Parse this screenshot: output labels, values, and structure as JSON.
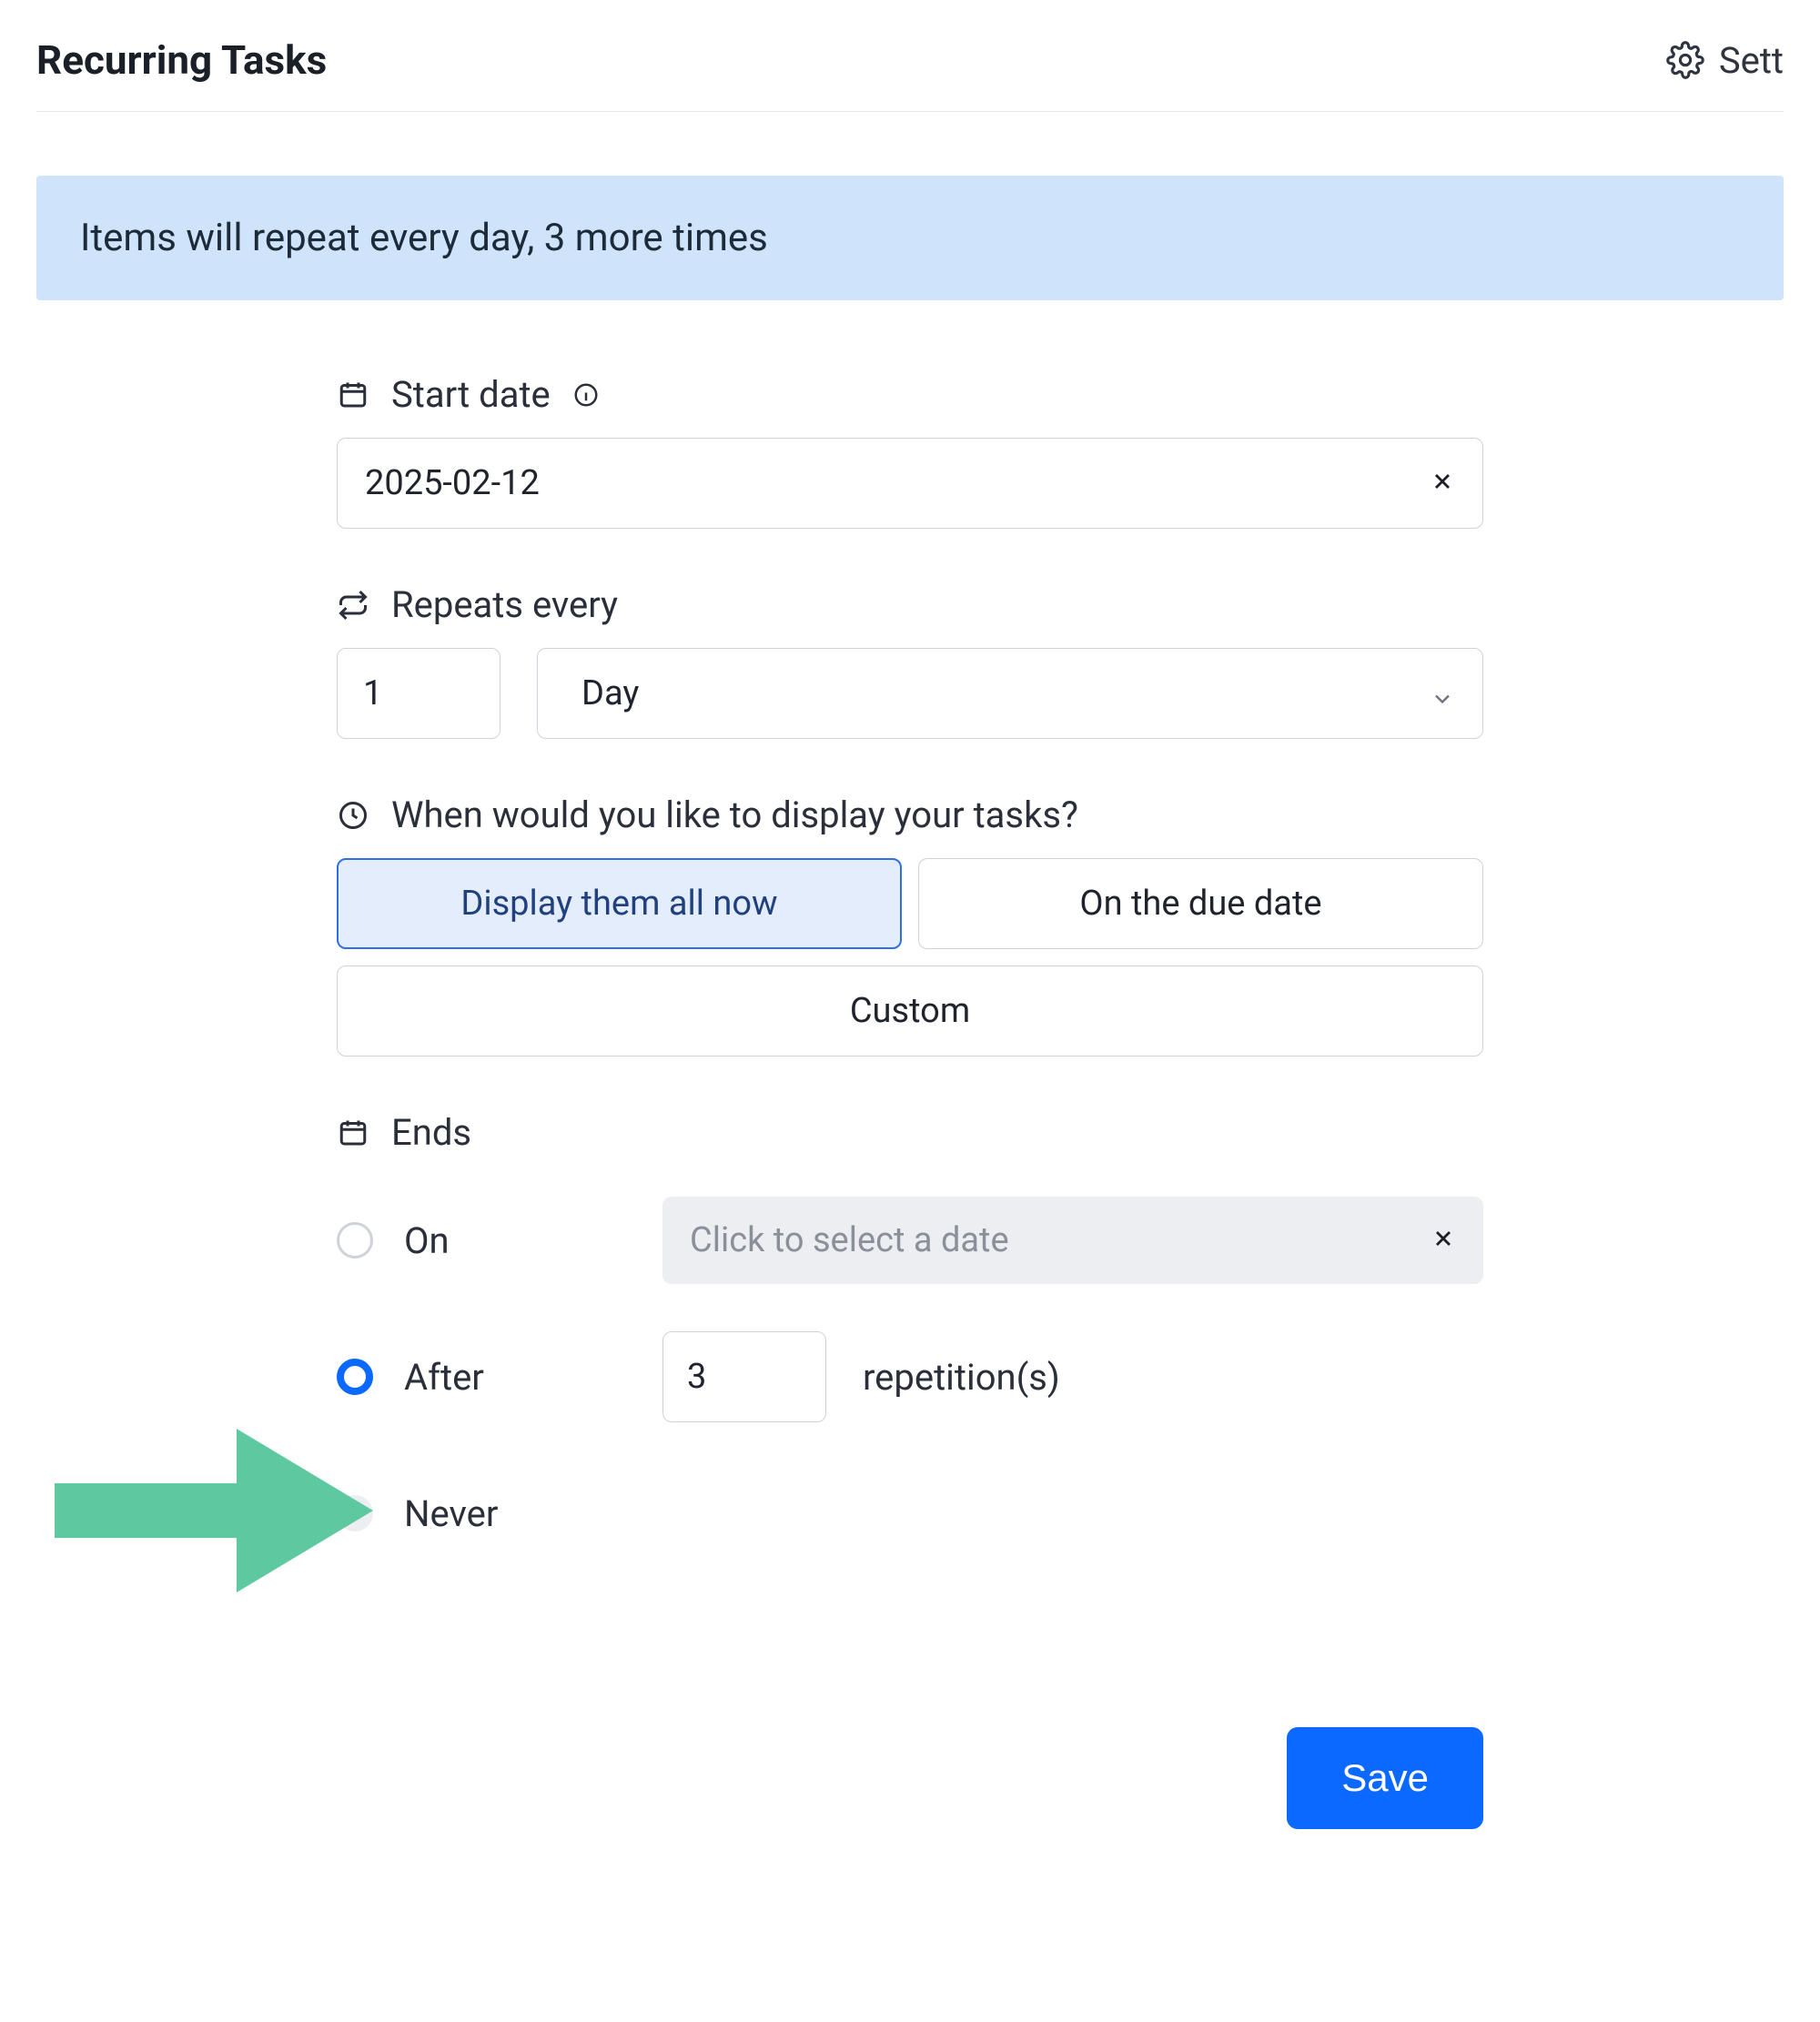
{
  "header": {
    "title": "Recurring Tasks",
    "settings_label": "Sett"
  },
  "banner": {
    "text": "Items will repeat every day, 3 more times"
  },
  "start_date": {
    "label": "Start date",
    "value": "2025-02-12"
  },
  "repeats": {
    "label": "Repeats every",
    "count": "1",
    "unit": "Day"
  },
  "display": {
    "label": "When would you like to display your tasks?",
    "option_all": "Display them all now",
    "option_due": "On the due date",
    "option_custom": "Custom",
    "selected": "all"
  },
  "ends": {
    "label": "Ends",
    "on_label": "On",
    "on_placeholder": "Click to select a date",
    "after_label": "After",
    "after_value": "3",
    "after_suffix": "repetition(s)",
    "never_label": "Never",
    "selected": "after"
  },
  "actions": {
    "save": "Save"
  }
}
